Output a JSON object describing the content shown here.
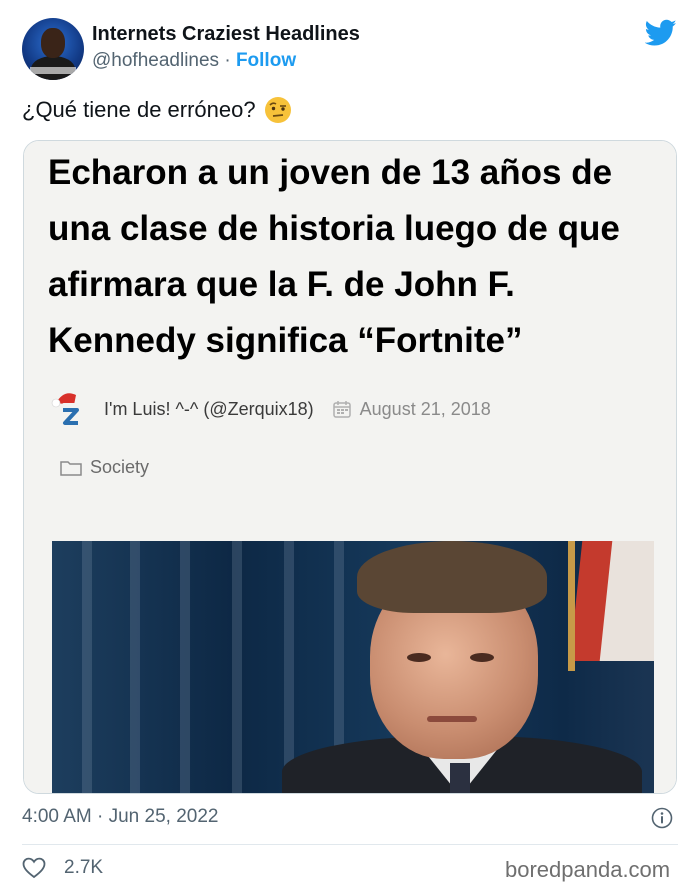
{
  "tweet": {
    "display_name": "Internets Craziest Headlines",
    "handle": "@hofheadlines",
    "separator": "·",
    "follow_label": "Follow",
    "text": "¿Qué tiene de erróneo?",
    "emoji": "face-with-raised-eyebrow",
    "timestamp": "4:00 AM · Jun 25, 2022",
    "likes": "2.7K"
  },
  "card": {
    "headline": "Echaron a un joven de 13 años de una clase de historia luego de que afirmara que la F. de John F. Kennedy significa “Fortnite”",
    "author": "I'm Luis! ^-^ (@Zerquix18)",
    "date": "August 21, 2018",
    "category": "Society"
  },
  "watermark": "boredpanda.com",
  "icons": {
    "platform": "twitter-bird-icon",
    "author_avatar": "z-santa-hat-icon",
    "date": "calendar-icon",
    "category": "folder-icon",
    "info": "info-icon",
    "like": "heart-icon"
  },
  "colors": {
    "accent": "#1d9bf0",
    "secondary_text": "#536471",
    "border": "#cfd9de"
  }
}
